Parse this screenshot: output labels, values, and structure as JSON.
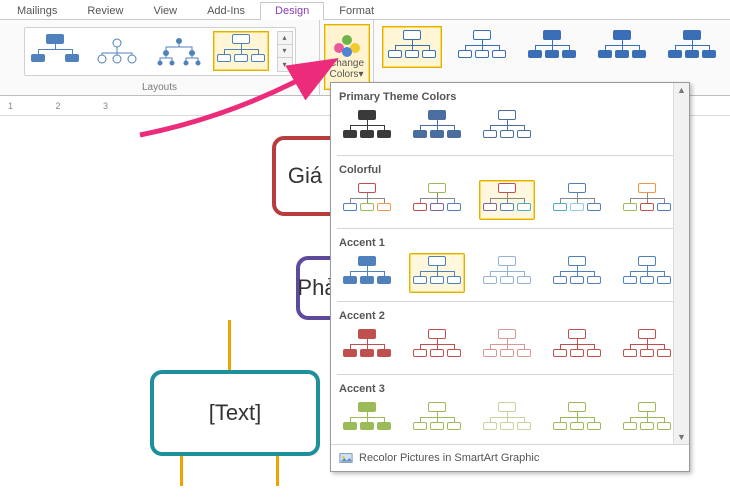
{
  "tabs": {
    "items": [
      {
        "label": "Mailings"
      },
      {
        "label": "Review"
      },
      {
        "label": "View"
      },
      {
        "label": "Add-Ins"
      },
      {
        "label": "Design",
        "active": true
      },
      {
        "label": "Format"
      }
    ]
  },
  "ribbon": {
    "layouts_label": "Layouts",
    "change_colors_label": "Change Colors",
    "change_colors_caret": "▾"
  },
  "ruler": {
    "marks": "1           2           3"
  },
  "canvas": {
    "node1": "Giá",
    "node2": "Phả",
    "node3": "[Text]"
  },
  "colors_dropdown": {
    "sections": {
      "primary": "Primary Theme Colors",
      "colorful": "Colorful",
      "accent1": "Accent 1",
      "accent2": "Accent 2",
      "accent3": "Accent 3"
    },
    "footer": "Recolor Pictures in SmartArt Graphic",
    "scroll_up": "▲",
    "scroll_down": "▼"
  },
  "colors": {
    "primary": [
      "#3a3a3a",
      "#4a6ea0",
      "#4a6ea0"
    ],
    "colorful": [
      "#c0504d,#4f81bd",
      "#9bbb59,#c0504d",
      "#c0504d,#4f81bd",
      "#4f81bd,#8ecfe8",
      "#f79646,#9bbb59"
    ],
    "accent1": [
      "#4f81bd",
      "#95b3d7",
      "#b8cce4",
      "#4f81bd",
      "#4f81bd"
    ],
    "accent2": [
      "#c0504d",
      "#da9694",
      "#c0504d",
      "#c0504d",
      "#c0504d"
    ],
    "accent3": [
      "#9bbb59",
      "#c3d69b",
      "#9bbb59",
      "#9bbb59",
      "#9bbb59"
    ]
  },
  "layouts": {
    "items": [
      "hier1",
      "hier2",
      "hier3",
      "hier4"
    ],
    "selected_index": 3
  },
  "styles": {
    "selected_index": 0,
    "colors": [
      "#3a6fb7",
      "#3a6fb7",
      "#3a6fb7",
      "#3a6fb7",
      "#3a6fb7"
    ]
  },
  "dd_selected": {
    "colorful": 2,
    "accent1": 1
  }
}
